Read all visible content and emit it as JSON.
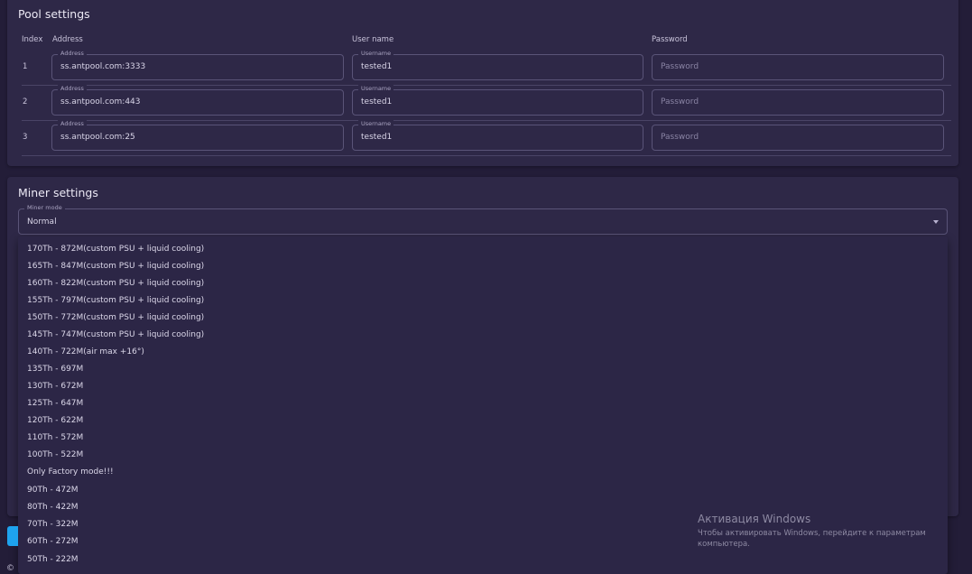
{
  "pool": {
    "title": "Pool settings",
    "headers": {
      "index": "Index",
      "address": "Address",
      "username": "User name",
      "password": "Password"
    },
    "field_labels": {
      "address": "Address",
      "username": "Username"
    },
    "password_placeholder": "Password",
    "rows": [
      {
        "index": "1",
        "address": "ss.antpool.com:3333",
        "username": "tested1"
      },
      {
        "index": "2",
        "address": "ss.antpool.com:443",
        "username": "tested1"
      },
      {
        "index": "3",
        "address": "ss.antpool.com:25",
        "username": "tested1"
      }
    ]
  },
  "miner": {
    "title": "Miner settings",
    "mode_label": "Miner mode",
    "mode_value": "Normal",
    "options": [
      "170Th - 872M(custom PSU + liquid cooling)",
      "165Th - 847M(custom PSU + liquid cooling)",
      "160Th - 822M(custom PSU + liquid cooling)",
      "155Th - 797M(custom PSU + liquid cooling)",
      "150Th - 772M(custom PSU + liquid cooling)",
      "145Th - 747M(custom PSU + liquid cooling)",
      "140Th - 722M(air max +16°)",
      "135Th - 697M",
      "130Th - 672M",
      "125Th - 647M",
      "120Th - 622M",
      "110Th - 572M",
      "100Th - 522M",
      "Only Factory mode!!!",
      "90Th - 472M",
      "80Th - 422M",
      "70Th - 322M",
      "60Th - 272M",
      "50Th - 222M"
    ]
  },
  "watermark": {
    "title": "Активация Windows",
    "subtitle": "Чтобы активировать Windows, перейдите к параметрам компьютера."
  },
  "footer_glyph": "©",
  "colors": {
    "accent": "#1ea3ee",
    "background": "#231d38",
    "card": "#2e2847"
  }
}
